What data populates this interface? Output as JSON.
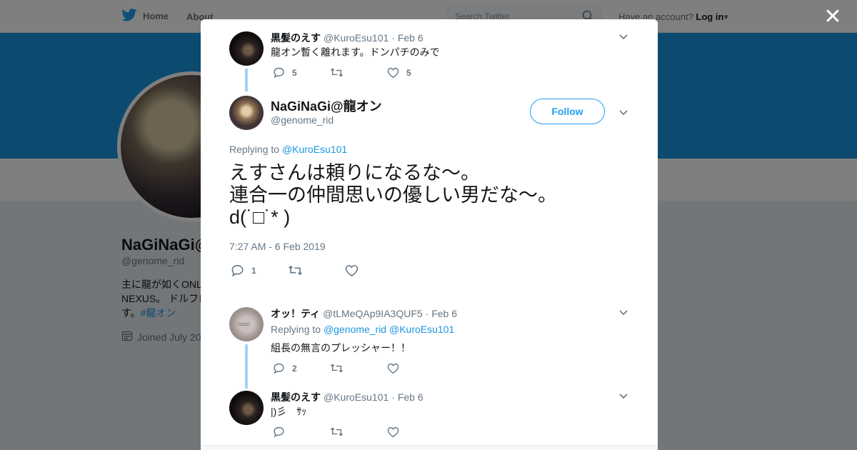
{
  "nav": {
    "home": "Home",
    "about": "About",
    "search_placeholder": "Search Twitter",
    "have_account": "Have an account?",
    "login": "Log in"
  },
  "profile": {
    "name": "NaGiNaGi@",
    "handle": "@genome_rid",
    "bio_line1": "主に龍が如くONL",
    "bio_line2": "NEXUS。 ドルフロ",
    "bio_line3_prefix": "す。",
    "bio_tag": "#龍オン",
    "joined": "Joined July 20"
  },
  "tweets": [
    {
      "name": "黒髪のえす",
      "handle": "@KuroEsu101",
      "date": "· Feb 6",
      "text": "龍オン暫く離れます。ドンパチのみで",
      "reply_count": "5",
      "retweet_count": "",
      "like_count": "5"
    },
    {
      "name": "オッ！ティ",
      "handle": "@tLMeQAp9IA3QUF5",
      "date": "· Feb 6",
      "replying_label": "Replying to",
      "replying_to1": "@genome_rid",
      "replying_to2": "@KuroEsu101",
      "text": "組長の無言のプレッシャー！！",
      "reply_count": "2",
      "retweet_count": "",
      "like_count": ""
    },
    {
      "name": "黒髪のえす",
      "handle": "@KuroEsu101",
      "date": "· Feb 6",
      "text": "|)彡　ｻｯ",
      "reply_count": "",
      "retweet_count": "",
      "like_count": ""
    }
  ],
  "main_tweet": {
    "name": "NaGiNaGi@龍オン",
    "handle": "@genome_rid",
    "follow_label": "Follow",
    "replying_label": "Replying to",
    "replying_to": "@KuroEsu101",
    "text": "えすさんは頼りになるな〜。\n連合一の仲間思いの優しい男だな〜。\nd(˙□˙* )",
    "timestamp": "7:27 AM - 6 Feb 2019",
    "reply_count": "1",
    "retweet_count": "",
    "like_count": ""
  },
  "colors": {
    "accent": "#1da1f2",
    "banner": "#1b95e0",
    "thread_line": "#a0d4f5"
  }
}
